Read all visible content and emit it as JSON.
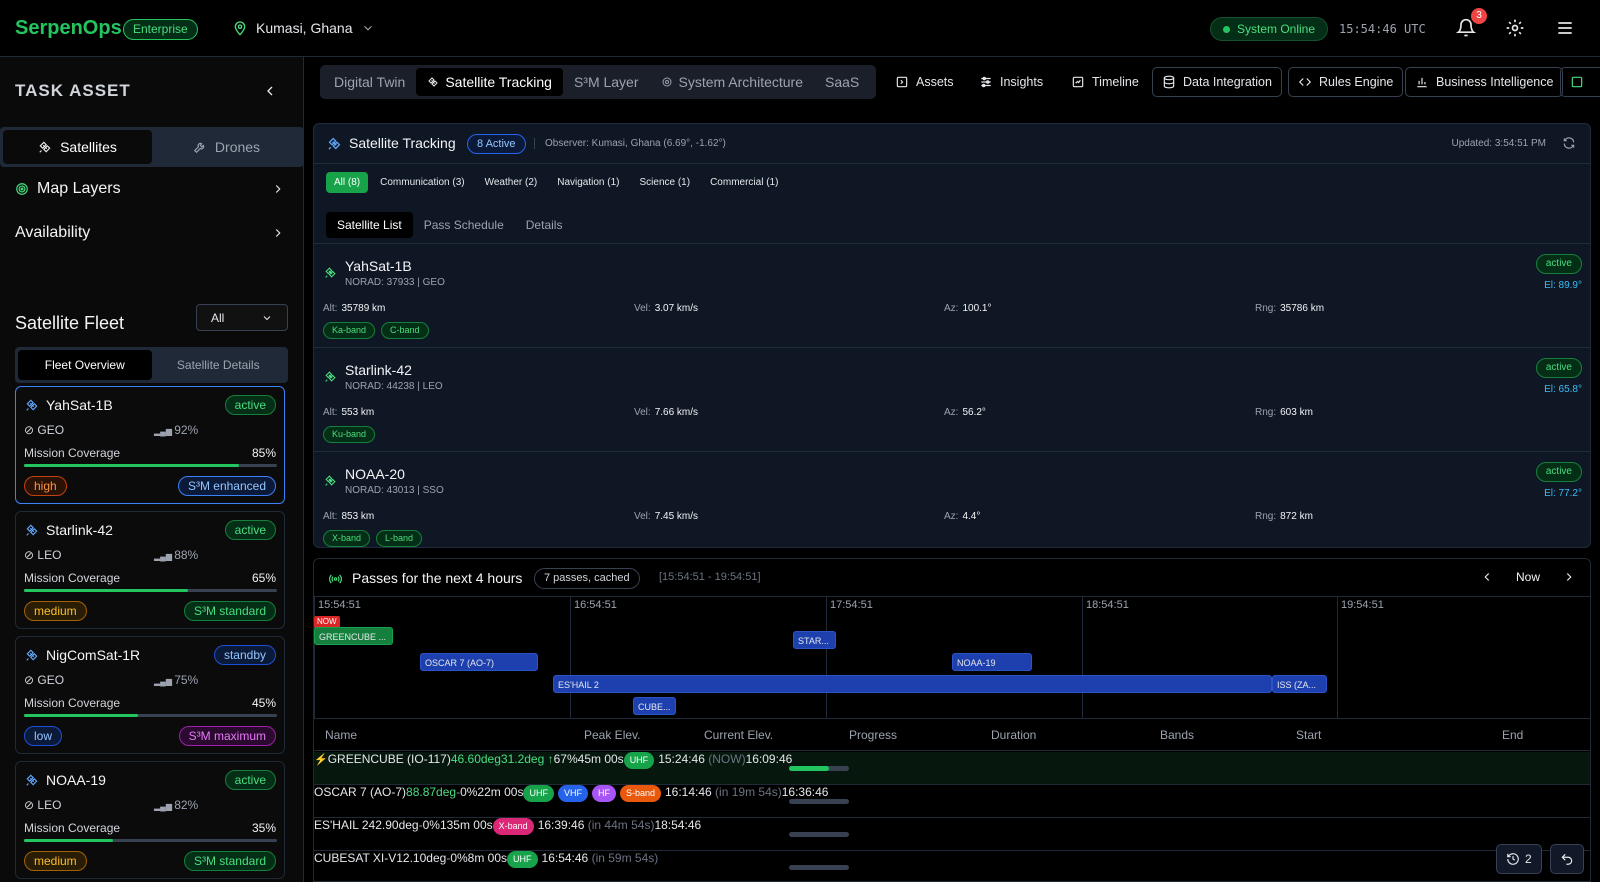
{
  "header": {
    "logo": "SerpenOps",
    "plan": "Enterprise",
    "location": "Kumasi, Ghana",
    "status": "System Online",
    "clock": "15:54:46 UTC",
    "notifications": "3"
  },
  "sidebar": {
    "title": "TASK ASSET",
    "tabs": [
      "Satellites",
      "Drones"
    ],
    "sections": [
      "Map Layers",
      "Availability"
    ],
    "fleet_title": "Satellite Fleet",
    "fleet_filter": "All",
    "fleet_tabs": [
      "Fleet Overview",
      "Satellite Details"
    ],
    "cards": [
      {
        "name": "YahSat-1B",
        "status": "active",
        "orbit": "GEO",
        "signal": "92%",
        "coverage_label": "Mission Coverage",
        "coverage": "85%",
        "coverage_value": 85,
        "priority": "high",
        "s3": "S³M enhanced"
      },
      {
        "name": "Starlink-42",
        "status": "active",
        "orbit": "LEO",
        "signal": "88%",
        "coverage_label": "Mission Coverage",
        "coverage": "65%",
        "coverage_value": 65,
        "priority": "medium",
        "s3": "S³M standard"
      },
      {
        "name": "NigComSat-1R",
        "status": "standby",
        "orbit": "GEO",
        "signal": "75%",
        "coverage_label": "Mission Coverage",
        "coverage": "45%",
        "coverage_value": 45,
        "priority": "low",
        "s3": "S³M maximum"
      },
      {
        "name": "NOAA-19",
        "status": "active",
        "orbit": "LEO",
        "signal": "82%",
        "coverage_label": "Mission Coverage",
        "coverage": "35%",
        "coverage_value": 35,
        "priority": "medium",
        "s3": "S³M standard"
      }
    ]
  },
  "nav": {
    "tabs": [
      "Digital Twin",
      "Satellite Tracking",
      "S³M Layer",
      "System Architecture",
      "SaaS"
    ],
    "buttons": [
      "Assets",
      "Insights",
      "Timeline",
      "Data Integration",
      "Rules Engine",
      "Business Intelligence"
    ]
  },
  "tracking": {
    "title": "Satellite Tracking",
    "active": "8 Active",
    "observer": "Observer: Kumasi, Ghana (6.69°, -1.62°)",
    "updated": "Updated: 3:54:51 PM",
    "filters": [
      "All (8)",
      "Communication (3)",
      "Weather (2)",
      "Navigation (1)",
      "Science (1)",
      "Commercial (1)"
    ],
    "subtabs": [
      "Satellite List",
      "Pass Schedule",
      "Details"
    ],
    "labels": {
      "alt": "Alt:",
      "vel": "Vel:",
      "az": "Az:",
      "rng": "Rng:"
    },
    "satellites": [
      {
        "name": "YahSat-1B",
        "norad": "NORAD: 37933 | GEO",
        "status": "active",
        "el": "El: 89.9°",
        "alt": "35789 km",
        "vel": "3.07 km/s",
        "az": "100.1°",
        "rng": "35786 km",
        "tags": [
          "Ka-band",
          "C-band"
        ]
      },
      {
        "name": "Starlink-42",
        "norad": "NORAD: 44238 | LEO",
        "status": "active",
        "el": "El: 65.8°",
        "alt": "553 km",
        "vel": "7.66 km/s",
        "az": "56.2°",
        "rng": "603 km",
        "tags": [
          "Ku-band"
        ]
      },
      {
        "name": "NOAA-20",
        "norad": "NORAD: 43013 | SSO",
        "status": "active",
        "el": "El: 77.2°",
        "alt": "853 km",
        "vel": "7.45 km/s",
        "az": "4.4°",
        "rng": "872 km",
        "tags": [
          "X-band",
          "L-band"
        ]
      }
    ]
  },
  "passes": {
    "title": "Passes for the next 4 hours",
    "count": "7 passes, cached",
    "range": "[15:54:51 - 19:54:51]",
    "now": "Now",
    "now_marker": "NOW",
    "ticks": [
      "15:54:51",
      "16:54:51",
      "17:54:51",
      "18:54:51",
      "19:54:51"
    ],
    "bars": [
      "GREENCUBE ...",
      "STAR...",
      "OSCAR 7 (AO-7)",
      "NOAA-19",
      "ES'HAIL 2",
      "ISS (ZA...",
      "CUBE..."
    ],
    "columns": [
      "Name",
      "Peak Elev.",
      "Current Elev.",
      "Progress",
      "Duration",
      "Bands",
      "Start",
      "End"
    ],
    "rows": [
      {
        "name": "GREENCUBE (IO-117)",
        "peak": "46.60deg",
        "current": "31.2deg ↑",
        "progress": "67%",
        "progress_value": 67,
        "duration": "45m 00s",
        "bands": [
          "UHF"
        ],
        "start": "15:24:46",
        "start_note": "(NOW)",
        "end": "16:09:46"
      },
      {
        "name": "OSCAR 7 (AO-7)",
        "peak": "88.87deg",
        "current": "-",
        "progress": "0%",
        "progress_value": 0,
        "duration": "22m 00s",
        "bands": [
          "UHF",
          "VHF",
          "HF",
          "S-band"
        ],
        "start": "16:14:46",
        "start_note": "(in 19m 54s)",
        "end": "16:36:46"
      },
      {
        "name": "ES'HAIL 2",
        "peak": "42.90deg",
        "current": "-",
        "progress": "0%",
        "progress_value": 0,
        "duration": "135m 00s",
        "bands": [
          "X-band"
        ],
        "start": "16:39:46",
        "start_note": "(in 44m 54s)",
        "end": "18:54:46"
      },
      {
        "name": "CUBESAT XI-V",
        "peak": "12.10deg",
        "current": "-",
        "progress": "0%",
        "progress_value": 0,
        "duration": "8m 00s",
        "bands": [
          "UHF"
        ],
        "start": "16:54:46",
        "start_note": "(in 59m 54s)",
        "end": ""
      }
    ]
  },
  "floating": {
    "history_count": "2"
  },
  "colors": {
    "accent": "#22c55e",
    "blue": "#3b82f6",
    "UHF": "#16a34a",
    "VHF": "#2563eb",
    "HF": "#a855f7",
    "S-band": "#ea580c",
    "X-band": "#db2777"
  }
}
